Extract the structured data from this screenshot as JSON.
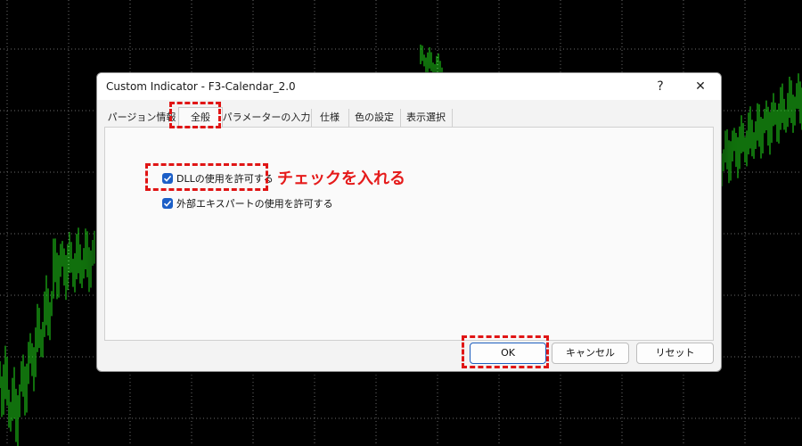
{
  "dialog": {
    "title": "Custom Indicator - F3-Calendar_2.0",
    "help_label": "?",
    "close_label": "✕"
  },
  "tabs": [
    {
      "label": "パージョン情報"
    },
    {
      "label": "全般"
    },
    {
      "label": "パラメーターの入力"
    },
    {
      "label": "仕様"
    },
    {
      "label": "色の設定"
    },
    {
      "label": "表示選択"
    }
  ],
  "options": {
    "allow_dll": {
      "label": "DLLの使用を許可する",
      "checked": true
    },
    "allow_experts": {
      "label": "外部エキスパートの使用を許可する",
      "checked": true
    }
  },
  "buttons": {
    "ok": "OK",
    "cancel": "キャンセル",
    "reset": "リセット"
  },
  "annotation": {
    "text": "チェックを入れる",
    "color": "#e51b1b"
  },
  "colors": {
    "chart_background": "#000000",
    "candles": "#22e01a",
    "checkbox": "#1c5fc7",
    "highlight": "#e01515"
  }
}
